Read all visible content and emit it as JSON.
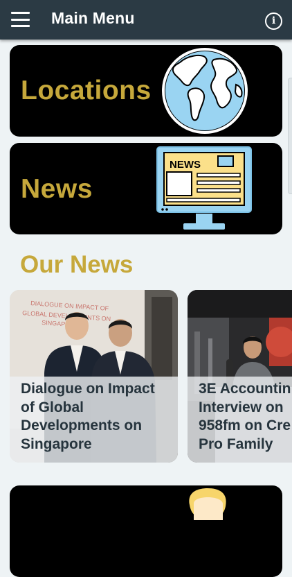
{
  "header": {
    "title": "Main Menu",
    "menu_icon": "hamburger-icon",
    "info_icon": "info-icon",
    "info_glyph": "i"
  },
  "tiles": [
    {
      "label": "Locations",
      "icon": "globe-icon"
    },
    {
      "label": "News",
      "icon": "news-monitor-icon",
      "icon_text": "NEWS"
    },
    {
      "label": "",
      "icon": "person-icon"
    }
  ],
  "section": {
    "title": "Our News"
  },
  "news_cards": [
    {
      "title": "Dialogue on Impact\nof Global\nDevelopments on\nSingapore",
      "photo_text": "DIALOGUE ON IMPACT OF\nGLOBAL DEVELOPMENTS ON\nSINGAPORE",
      "image": "two-men-in-suits-photo"
    },
    {
      "title": "3E Accountin\nInterview on\n958fm on Cre\nPro Family",
      "image": "radio-studio-interview-photo"
    }
  ],
  "colors": {
    "appbar": "#2b3a44",
    "background": "#eef3f5",
    "gold": "#c6a83b",
    "tile_bg": "#000000",
    "card_text": "#26343d"
  }
}
